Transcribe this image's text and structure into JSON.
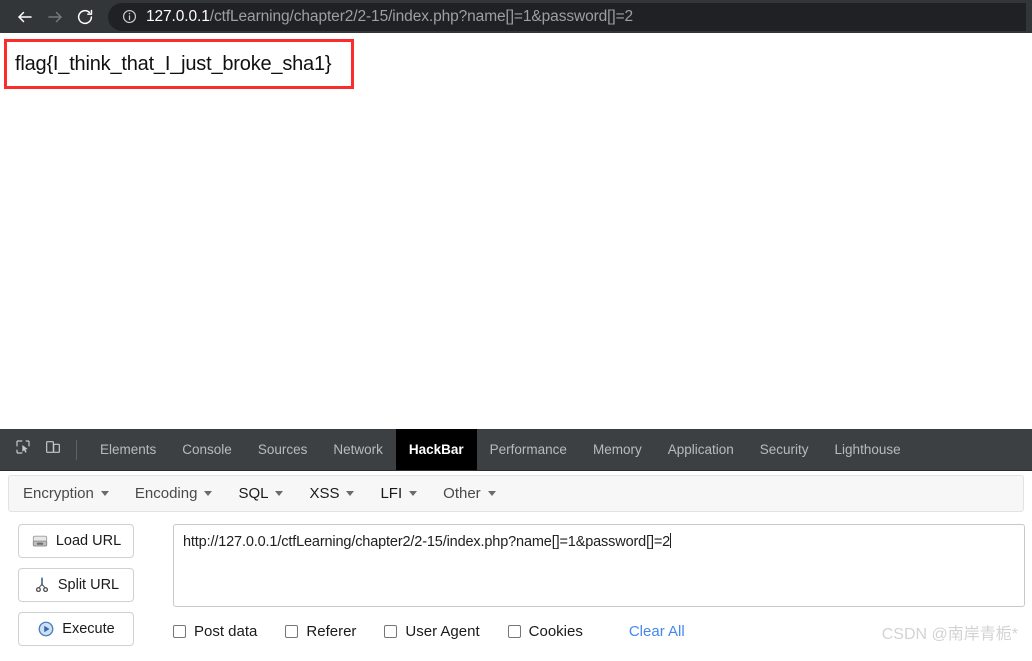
{
  "browser": {
    "back_icon": "arrow-left-icon",
    "forward_icon": "arrow-right-icon",
    "reload_icon": "reload-icon",
    "info_icon": "info-circle-icon",
    "url_host": "127.0.0.1",
    "url_path": "/ctfLearning/chapter2/2-15/index.php?name[]=1&password[]=2"
  },
  "page": {
    "flag_text": "flag{I_think_that_I_just_broke_sha1}",
    "highlight_color": "#fb2c2c"
  },
  "devtools": {
    "inspect_icon": "inspect-element-icon",
    "device_icon": "device-toolbar-icon",
    "tabs": [
      {
        "label": "Elements",
        "selected": false
      },
      {
        "label": "Console",
        "selected": false
      },
      {
        "label": "Sources",
        "selected": false
      },
      {
        "label": "Network",
        "selected": false
      },
      {
        "label": "HackBar",
        "selected": true
      },
      {
        "label": "Performance",
        "selected": false
      },
      {
        "label": "Memory",
        "selected": false
      },
      {
        "label": "Application",
        "selected": false
      },
      {
        "label": "Security",
        "selected": false
      },
      {
        "label": "Lighthouse",
        "selected": false
      }
    ]
  },
  "hackbar": {
    "menu": [
      {
        "label": "Encryption"
      },
      {
        "label": "Encoding"
      },
      {
        "label": "SQL"
      },
      {
        "label": "XSS"
      },
      {
        "label": "LFI"
      },
      {
        "label": "Other"
      }
    ],
    "buttons": [
      {
        "label": "Load URL",
        "icon": "load-url-icon"
      },
      {
        "label": "Split URL",
        "icon": "scissors-icon"
      },
      {
        "label": "Execute",
        "icon": "play-circle-icon"
      }
    ],
    "url_value": "http://127.0.0.1/ctfLearning/chapter2/2-15/index.php?name[]=1&password[]=2",
    "checkboxes": [
      {
        "label": "Post data",
        "checked": false
      },
      {
        "label": "Referer",
        "checked": false
      },
      {
        "label": "User Agent",
        "checked": false
      },
      {
        "label": "Cookies",
        "checked": false
      }
    ],
    "clear_all_label": "Clear All",
    "clear_all_color": "#4488ee"
  },
  "watermark": {
    "text": "CSDN @南岸青栀*"
  }
}
